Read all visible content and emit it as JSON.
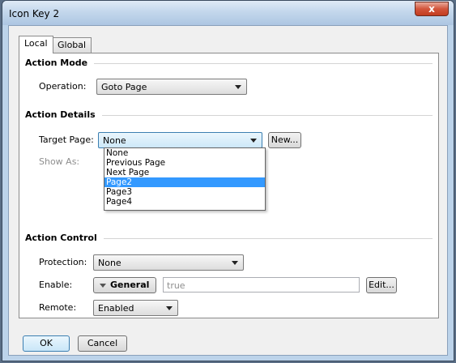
{
  "window": {
    "title": "Icon Key 2",
    "close_label": "x"
  },
  "tabs": [
    {
      "label": "Local"
    },
    {
      "label": "Global"
    }
  ],
  "action_mode": {
    "heading": "Action Mode",
    "operation_label": "Operation:",
    "operation_value": "Goto Page"
  },
  "action_details": {
    "heading": "Action Details",
    "target_page_label": "Target Page:",
    "target_page_value": "None",
    "new_button": "New...",
    "show_as_label": "Show As:",
    "options": [
      "None",
      "Previous Page",
      "Next Page",
      "Page2",
      "Page3",
      "Page4"
    ],
    "selected_option": "Page2"
  },
  "action_control": {
    "heading": "Action Control",
    "protection_label": "Protection:",
    "protection_value": "None",
    "enable_label": "Enable:",
    "enable_mode": "General",
    "enable_value": "true",
    "edit_button": "Edit...",
    "remote_label": "Remote:",
    "remote_value": "Enabled"
  },
  "footer": {
    "ok": "OK",
    "cancel": "Cancel"
  }
}
